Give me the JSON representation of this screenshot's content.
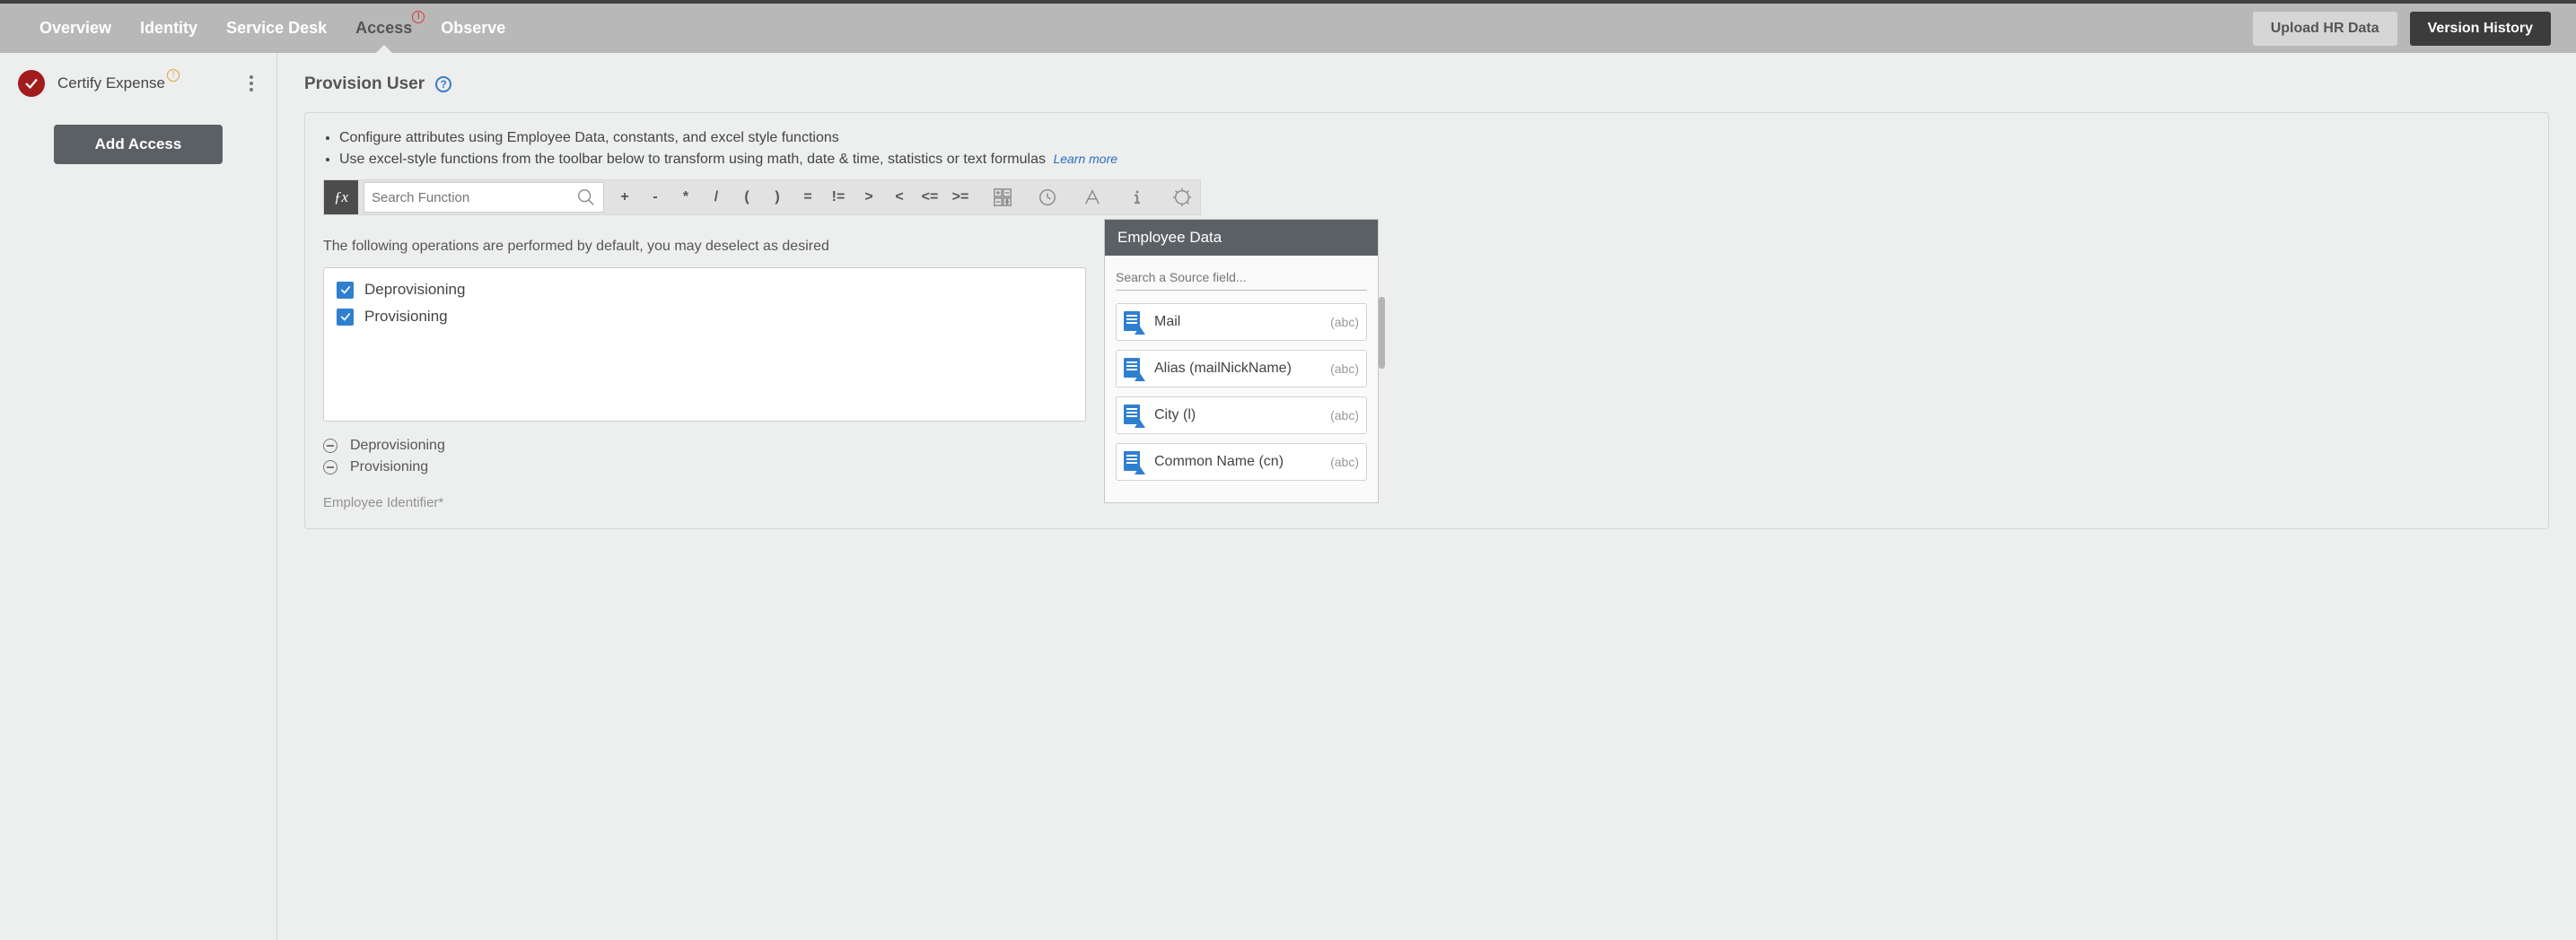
{
  "nav": {
    "tabs": [
      "Overview",
      "Identity",
      "Service Desk",
      "Access",
      "Observe"
    ],
    "active": "Access",
    "upload_btn": "Upload HR Data",
    "version_btn": "Version History"
  },
  "sidebar": {
    "item_label": "Certify Expense",
    "add_btn": "Add Access"
  },
  "page": {
    "title": "Provision User",
    "bullet1": "Configure attributes using Employee Data, constants, and excel style functions",
    "bullet2": "Use excel-style functions from the toolbar below to transform using math, date & time, statistics or text formulas",
    "learn_more": "Learn more",
    "fx_label": "ƒx",
    "search_placeholder": "Search Function",
    "operators": [
      "+",
      "-",
      "*",
      "/",
      "(",
      ")",
      "=",
      "!=",
      ">",
      "<",
      "<=",
      ">="
    ],
    "ops_desc": "The following operations are performed by default, you may deselect as desired",
    "operations": [
      "Deprovisioning",
      "Provisioning"
    ],
    "minus_ops": [
      "Deprovisioning",
      "Provisioning"
    ],
    "cutoff": "Employee Identifier*"
  },
  "employee_panel": {
    "title": "Employee Data",
    "search_placeholder": "Search a Source field...",
    "fields": [
      {
        "name": "Mail",
        "type": "(abc)"
      },
      {
        "name": "Alias (mailNickName)",
        "type": "(abc)"
      },
      {
        "name": "City (l)",
        "type": "(abc)"
      },
      {
        "name": "Common Name (cn)",
        "type": "(abc)"
      }
    ]
  }
}
